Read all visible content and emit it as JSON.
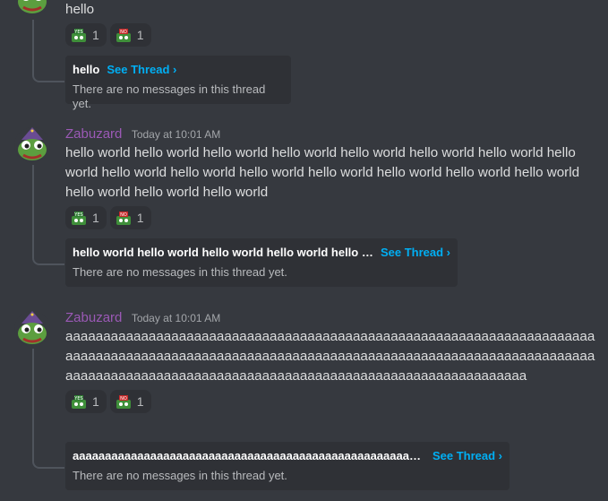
{
  "messages": [
    {
      "username": "",
      "timestamp": "",
      "text": "hello",
      "reactions": [
        {
          "icon": "frog-yes-emoji",
          "count": "1"
        },
        {
          "icon": "frog-no-emoji",
          "count": "1"
        }
      ],
      "thread": {
        "name": "hello",
        "see_thread": "See Thread ›",
        "subtitle": "There are no messages in this thread yet."
      }
    },
    {
      "username": "Zabuzard",
      "timestamp": "Today at 10:01 AM",
      "text": "hello world hello world hello world hello world hello world hello world hello world hello world hello world hello world hello world hello world hello world hello world hello world hello world hello world hello world",
      "reactions": [
        {
          "icon": "frog-yes-emoji",
          "count": "1"
        },
        {
          "icon": "frog-no-emoji",
          "count": "1"
        }
      ],
      "thread": {
        "name": "hello world hello world hello world hello world hello world",
        "see_thread": "See Thread ›",
        "subtitle": "There are no messages in this thread yet."
      }
    },
    {
      "username": "Zabuzard",
      "timestamp": "Today at 10:01 AM",
      "text": "aaaaaaaaaaaaaaaaaaaaaaaaaaaaaaaaaaaaaaaaaaaaaaaaaaaaaaaaaaaaaaaaaaaaaaaaaaaaaaaaaaaaaaaaaaaaaaaaaaaaaaaaaaaaaaaaaaaaaaaaaaaaaaaaaaaaaaaaaaaaaaaaaaaaaaaaaaaaaaaaaaaaaaaaaaaaaaaaaaaaaaaaaaaaaaaaaaaaaaaaa",
      "reactions": [
        {
          "icon": "frog-yes-emoji",
          "count": "1"
        },
        {
          "icon": "frog-no-emoji",
          "count": "1"
        }
      ],
      "thread": {
        "name": "aaaaaaaaaaaaaaaaaaaaaaaaaaaaaaaaaaaaaaaaaaaaaaaaaaaaa...",
        "see_thread": "See Thread ›",
        "subtitle": "There are no messages in this thread yet."
      }
    }
  ]
}
